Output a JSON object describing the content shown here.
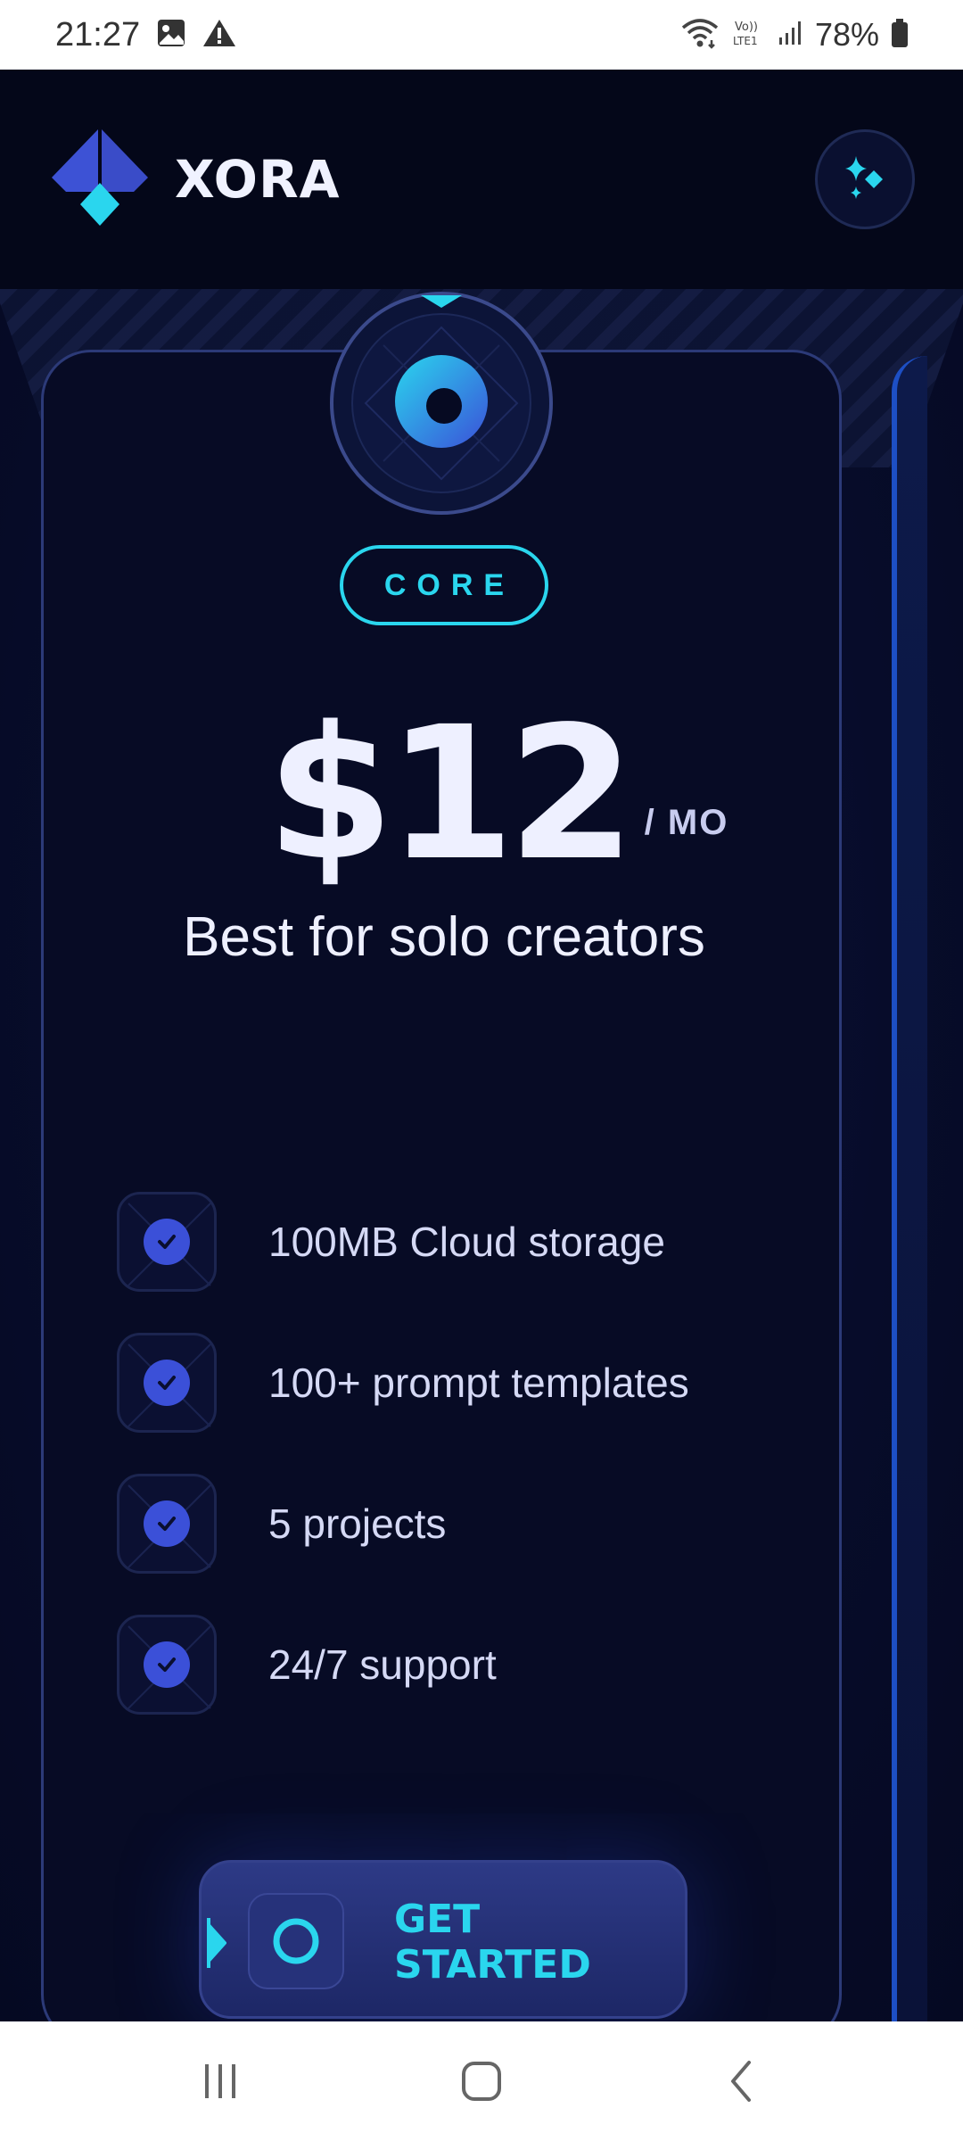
{
  "status_bar": {
    "time": "21:27",
    "battery": "78%",
    "icons": [
      "gallery-icon",
      "warning-icon",
      "wifi-icon",
      "volte-icon",
      "signal-icon",
      "battery-icon"
    ]
  },
  "header": {
    "brand_name": "XORA",
    "logo_icon": "xora-logo-icon",
    "action_icon": "sparkle-icon"
  },
  "plan": {
    "tier": "CORE",
    "price": "$12",
    "period": "/ MO",
    "tagline": "Best for solo creators",
    "features": [
      "100MB Cloud storage",
      "100+ prompt templates",
      "5 projects",
      "24/7 support"
    ],
    "cta_label": "GET STARTED"
  },
  "nav_bar": {
    "buttons": [
      "recent-apps-icon",
      "home-icon",
      "back-icon"
    ]
  },
  "colors": {
    "accent_cyan": "#2ad6ee",
    "accent_blue": "#3b50d8",
    "background": "#070b25"
  }
}
